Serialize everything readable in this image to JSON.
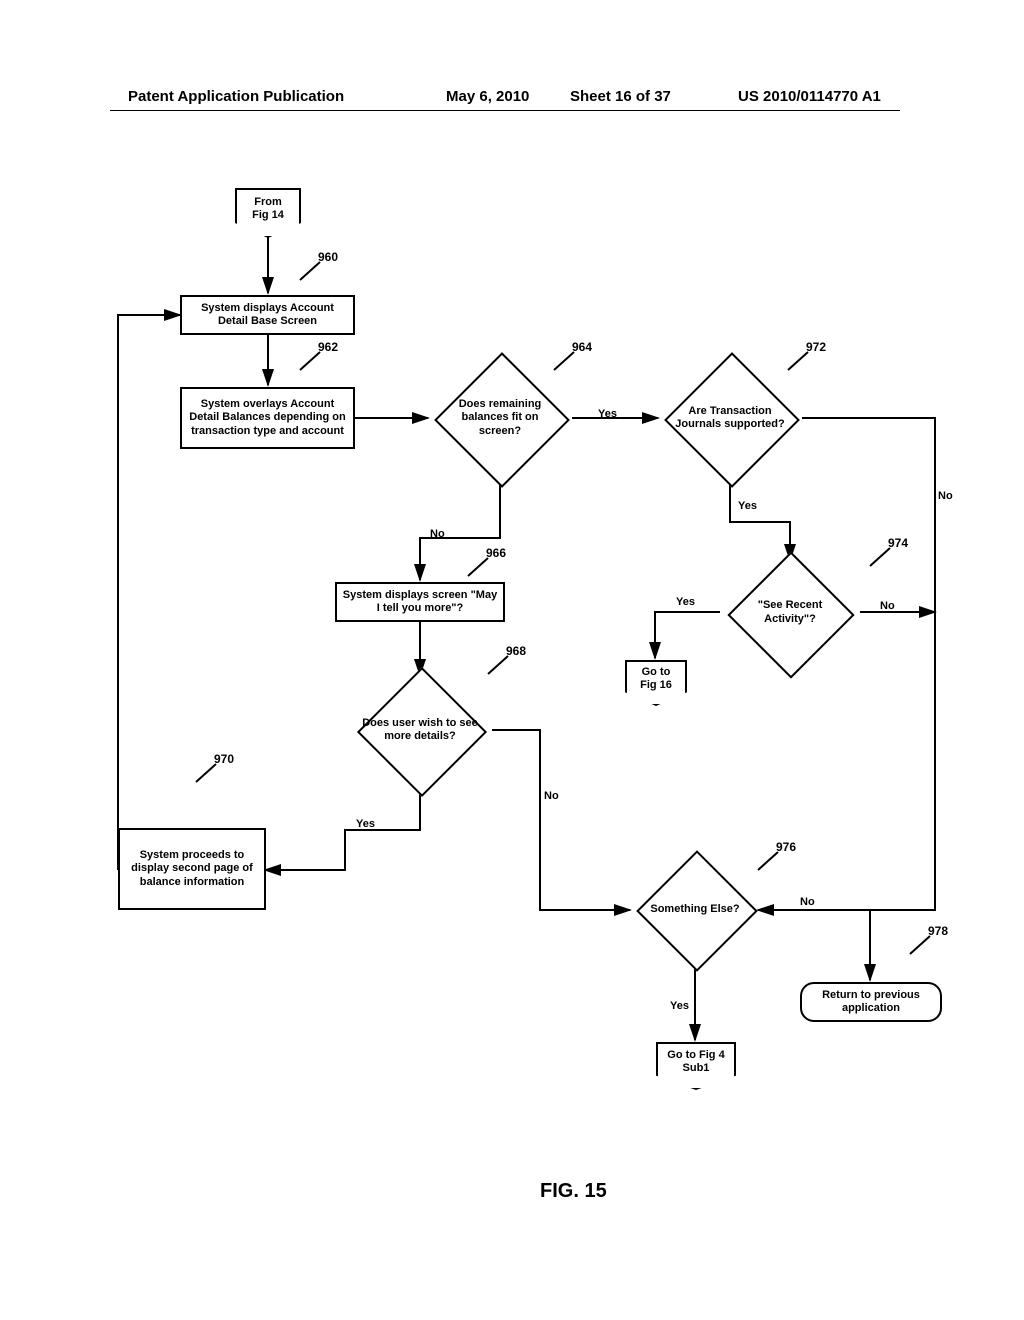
{
  "header": {
    "left": "Patent Application Publication",
    "date": "May 6, 2010",
    "sheet": "Sheet 16 of 37",
    "pub": "US 2010/0114770 A1"
  },
  "figure_label": "FIG. 15",
  "nodes": {
    "from": "From\nFig 14",
    "n960": "System displays Account\nDetail Base Screen",
    "n962": "System overlays Account\nDetail Balances depending\non transaction type and\naccount",
    "n964": "Does remaining\nbalances fit on\nscreen?",
    "n966": "System displays screen\n\"May I tell you more\"?",
    "n968": "Does user wish to\nsee more details?",
    "n970": "System proceeds to\ndisplay second page\nof balance\ninformation",
    "n972": "Are Transaction\nJournals supported?",
    "n974": "\"See Recent Activity\"?",
    "n976": "Something Else?",
    "n978": "Return to previous\napplication",
    "goto16": "Go to\nFig 16",
    "goto4": "Go to Fig 4\nSub1"
  },
  "refs": {
    "r960": "960",
    "r962": "962",
    "r964": "964",
    "r966": "966",
    "r968": "968",
    "r970": "970",
    "r972": "972",
    "r974": "974",
    "r976": "976",
    "r978": "978"
  },
  "edges": {
    "yes": "Yes",
    "no": "No"
  }
}
